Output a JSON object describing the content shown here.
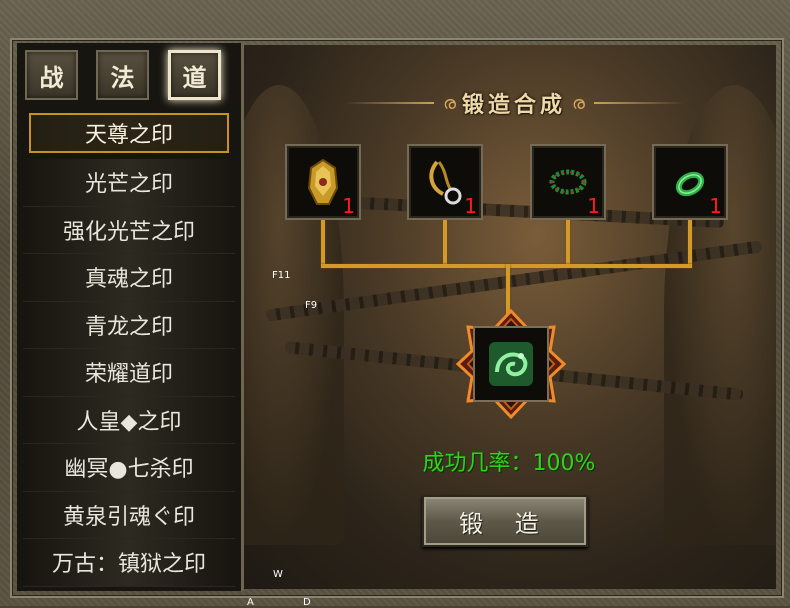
{
  "tabs": [
    {
      "label": "战",
      "active": false
    },
    {
      "label": "法",
      "active": false
    },
    {
      "label": "道",
      "active": true
    }
  ],
  "seals": [
    "天尊之印",
    "光芒之印",
    "强化光芒之印",
    "真魂之印",
    "青龙之印",
    "荣耀道印",
    "人皇◆之印",
    "幽冥●七杀印",
    "黄泉引魂ぐ印",
    "万古：镇狱之印"
  ],
  "selected_seal_index": 0,
  "forge": {
    "title": "锻造合成",
    "materials": [
      {
        "icon": "golden-armor-icon",
        "qty": "1"
      },
      {
        "icon": "gold-necklace-icon",
        "qty": "1"
      },
      {
        "icon": "jade-bracelet-icon",
        "qty": "1"
      },
      {
        "icon": "jade-ring-icon",
        "qty": "1"
      }
    ],
    "result_icon": "jade-dragon-seal-icon",
    "success_rate": "成功几率：100%",
    "button_label": "锻 造"
  },
  "hotkeys": {
    "f11": "F11",
    "f9": "F9",
    "w": "W",
    "a": "A",
    "d": "D"
  },
  "colors": {
    "accent_gold": "#d39a2a",
    "quantity_red": "#ff1b1b",
    "success_green": "#2ed31c",
    "selected_border": "#c9921e"
  }
}
